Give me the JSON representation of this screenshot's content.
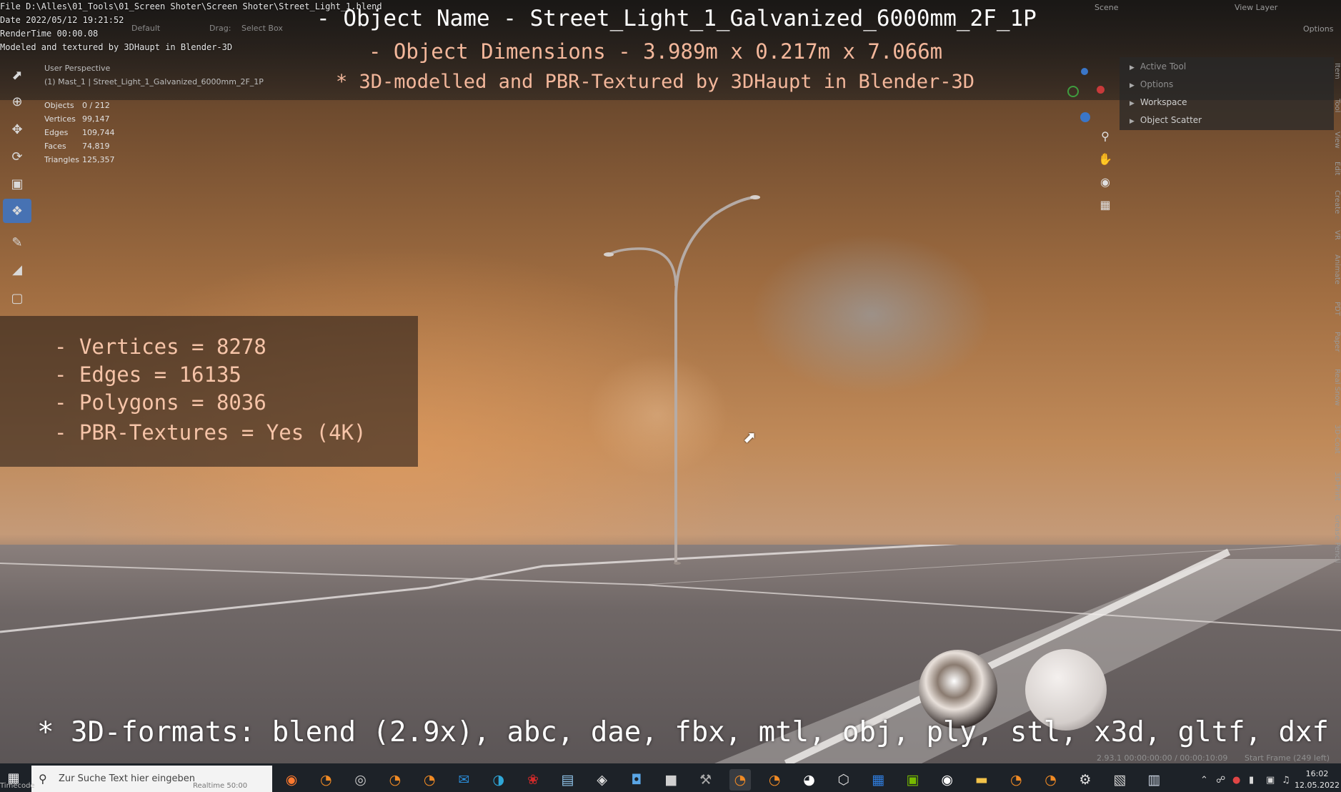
{
  "header": {
    "file_path": "File D:\\Alles\\01_Tools\\01_Screen Shoter\\Screen Shoter\\Street_Light_1.blend",
    "date": "Date 2022/05/12 19:21:52",
    "render_time": "RenderTime 00:00.08",
    "modeled_by": "Modeled and textured by 3DHaupt in Blender-3D",
    "mode_default": "Default",
    "drag_label": "Drag:",
    "select_box": "Select Box",
    "scene": "Scene",
    "view_layer": "View Layer",
    "options": "Options"
  },
  "overlay_titles": {
    "object_name": "- Object Name - Street_Light_1_Galvanized_6000mm_2F_1P",
    "dimensions": "- Object Dimensions -  3.989m x 0.217m x 7.066m",
    "credits": "* 3D-modelled and PBR-Textured by 3DHaupt in Blender-3D"
  },
  "viewport": {
    "perspective": "User Perspective",
    "selection": "(1) Mast_1 | Street_Light_1_Galvanized_6000mm_2F_1P",
    "stats": [
      {
        "label": "Objects",
        "value": "0 / 212"
      },
      {
        "label": "Vertices",
        "value": "99,147"
      },
      {
        "label": "Edges",
        "value": "109,744"
      },
      {
        "label": "Faces",
        "value": "74,819"
      },
      {
        "label": "Triangles",
        "value": "125,357"
      }
    ]
  },
  "info_box": {
    "lines": [
      "- Vertices = 8278",
      "- Edges = 16135",
      "- Polygons = 8036",
      "- PBR-Textures =  Yes (4K)"
    ]
  },
  "n_panel": {
    "items": [
      {
        "label": "Active Tool",
        "dim": true
      },
      {
        "label": "Options",
        "dim": true
      },
      {
        "label": "Workspace",
        "dim": false
      },
      {
        "label": "Object Scatter",
        "dim": false
      }
    ],
    "side_tabs": [
      "Item",
      "Tool",
      "View",
      "Edit",
      "Create",
      "VR",
      "Animate",
      "PDT",
      "Paper",
      "Real Snow",
      "3D-Coat",
      "3D-Print",
      "Grease Pencil"
    ]
  },
  "formats_line": "* 3D-formats: blend (2.9x), abc, dae, fbx, mtl, obj, ply, stl, x3d, gltf, dxf",
  "status_bar": {
    "version_time": "2.93.1  00:00:00:00 / 00:00:10:09",
    "start_frame": "Start Frame (249 left)",
    "timecode": "Timecode",
    "bottom_tag": "Realtime 50:00"
  },
  "taskbar": {
    "search_placeholder": "Zur Suche Text hier eingeben",
    "time": "16:02",
    "date": "12.05.2022",
    "apps": [
      {
        "icon": "firefox-icon",
        "color": "#ff7a2f"
      },
      {
        "icon": "blender-icon",
        "color": "#f08a24"
      },
      {
        "icon": "steam-icon",
        "color": "#c8c8c8"
      },
      {
        "icon": "blender-icon",
        "color": "#f08a24"
      },
      {
        "icon": "blender-icon",
        "color": "#f08a24"
      },
      {
        "icon": "mail-icon",
        "color": "#2a8bd6"
      },
      {
        "icon": "edge-icon",
        "color": "#2fa7d8"
      },
      {
        "icon": "app-red-icon",
        "color": "#d22a2a"
      },
      {
        "icon": "notes-icon",
        "color": "#8fc2e8"
      },
      {
        "icon": "app-icon",
        "color": "#e0e0e0"
      },
      {
        "icon": "shield-icon",
        "color": "#5aa6e6"
      },
      {
        "icon": "terminal-icon",
        "color": "#cfcfcf"
      },
      {
        "icon": "tool-icon",
        "color": "#aaaaaa"
      },
      {
        "icon": "blender-icon",
        "color": "#f08a24"
      },
      {
        "icon": "blender-icon",
        "color": "#f08a24"
      },
      {
        "icon": "panda-icon",
        "color": "#ffffff"
      },
      {
        "icon": "cube-icon",
        "color": "#dddddd"
      },
      {
        "icon": "calendar-icon",
        "color": "#2f7ee0"
      },
      {
        "icon": "nvidia-icon",
        "color": "#76b900"
      },
      {
        "icon": "obs-icon",
        "color": "#ffffff"
      },
      {
        "icon": "folder-icon",
        "color": "#f3c34a"
      },
      {
        "icon": "blender-icon",
        "color": "#f08a24"
      },
      {
        "icon": "blender-icon",
        "color": "#f08a24"
      },
      {
        "icon": "gear-icon",
        "color": "#e0e0e0"
      },
      {
        "icon": "network-icon",
        "color": "#cfcfcf"
      },
      {
        "icon": "window-icon",
        "color": "#cfd8e6"
      }
    ]
  },
  "colors": {
    "accent": "#4772b3",
    "title_white": "#ffffff",
    "title_peach": "#f3b79b"
  }
}
